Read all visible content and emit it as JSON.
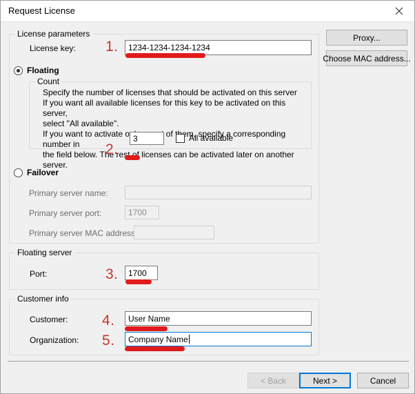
{
  "window": {
    "title": "Request License",
    "close_icon": "close-icon"
  },
  "license_parameters": {
    "legend": "License parameters",
    "license_key_label": "License key:",
    "license_key_value": "1234-1234-1234-1234",
    "floating_radio_label": "Floating",
    "failover_radio_label": "Failover",
    "count": {
      "legend": "Count",
      "description": "Specify the number of licenses that should be activated on this server\nIf you want all available licenses for this key to be activated on this server,\nselect \"All available\".\nIf you want to activate only a part of them, specify a corresponding number in\nthe field below. The rest of licenses can be activated later on another server.",
      "count_value": "3",
      "all_available_label": "All available"
    },
    "failover": {
      "primary_server_name_label": "Primary server name:",
      "primary_server_name_value": "",
      "primary_server_port_label": "Primary server port:",
      "primary_server_port_value": "1700",
      "primary_server_mac_label": "Primary server MAC address:",
      "primary_server_mac_value": ""
    }
  },
  "floating_server": {
    "legend": "Floating server",
    "port_label": "Port:",
    "port_value": "1700"
  },
  "customer_info": {
    "legend": "Customer info",
    "customer_label": "Customer:",
    "customer_value": "User Name",
    "organization_label": "Organization:",
    "organization_value": "Company Name"
  },
  "side_buttons": {
    "proxy": "Proxy...",
    "choose_mac": "Choose MAC address..."
  },
  "footer_buttons": {
    "back": "< Back",
    "next": "Next >",
    "cancel": "Cancel"
  },
  "annotations": {
    "n1": "1.",
    "n2": "2.",
    "n3": "3.",
    "n4": "4.",
    "n5": "5.",
    "color": "#c0392b",
    "underline_color": "#e01b1b"
  }
}
